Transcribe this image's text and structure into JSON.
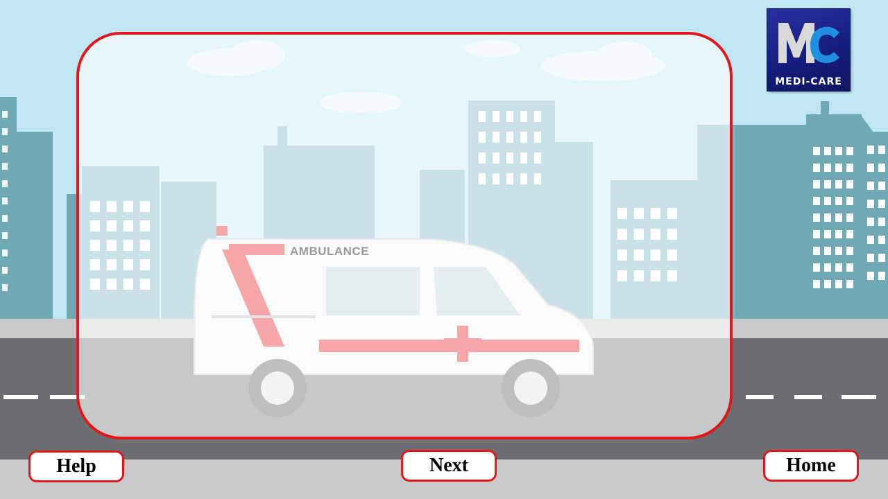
{
  "logo": {
    "text": "MEDI-CARE",
    "letters": "MC"
  },
  "vehicle": {
    "label": "AMBULANCE"
  },
  "buttons": {
    "help": "Help",
    "next": "Next",
    "home": "Home"
  },
  "colors": {
    "accent": "#e3161b",
    "sky": "#bfe6f3",
    "building": "#6fb3bd",
    "road": "#6d6e71",
    "logo_bg": "#1a237e"
  }
}
